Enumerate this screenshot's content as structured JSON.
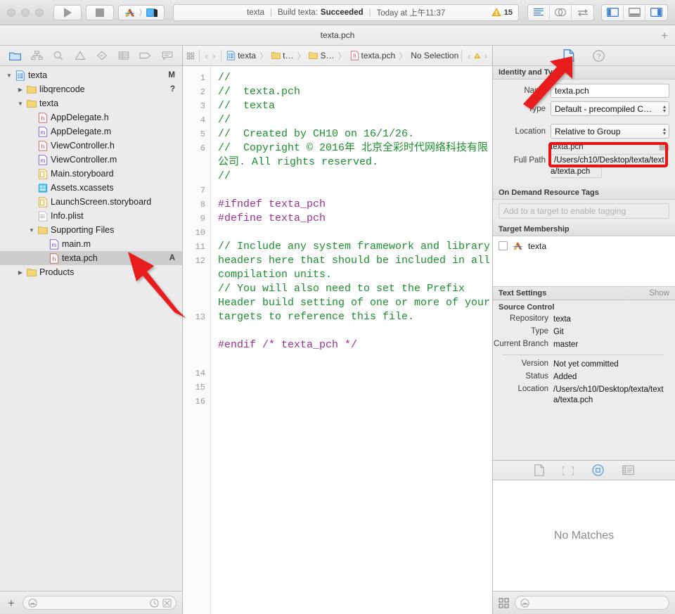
{
  "window": {
    "tab_title": "texta.pch"
  },
  "toolbar": {
    "run_icon": "play-icon",
    "stop_icon": "stop-icon",
    "scheme_name": "texta",
    "scheme_chevron": "〉",
    "activity": {
      "project": "texta",
      "sep": "|",
      "build_prefix": "Build texta:",
      "build_status": "Succeeded",
      "time": "Today at 上午11:37",
      "warning_icon": "warning-triangle-icon",
      "warning_count": "15"
    },
    "editor_segment": [
      "standard-editor-icon",
      "assistant-editor-icon",
      "version-editor-icon"
    ],
    "view_segment": [
      "navigator-toggle-icon",
      "debug-area-toggle-icon",
      "utilities-toggle-icon"
    ]
  },
  "navigator": {
    "tabs": [
      "folder-icon",
      "source-control-icon",
      "search-icon",
      "warning-icon",
      "test-icon",
      "debug-icon",
      "breakpoint-icon",
      "report-icon"
    ],
    "items": [
      {
        "label": "texta",
        "indent": 0,
        "twisty": "open",
        "icon": "project-icon",
        "status": "M"
      },
      {
        "label": "libqrencode",
        "indent": 1,
        "twisty": "closed",
        "icon": "folder-icon",
        "status": "?"
      },
      {
        "label": "texta",
        "indent": 1,
        "twisty": "open",
        "icon": "folder-icon",
        "status": ""
      },
      {
        "label": "AppDelegate.h",
        "indent": 2,
        "twisty": "none",
        "icon": "h-file-icon",
        "status": ""
      },
      {
        "label": "AppDelegate.m",
        "indent": 2,
        "twisty": "none",
        "icon": "m-file-icon",
        "status": ""
      },
      {
        "label": "ViewController.h",
        "indent": 2,
        "twisty": "none",
        "icon": "h-file-icon",
        "status": ""
      },
      {
        "label": "ViewController.m",
        "indent": 2,
        "twisty": "none",
        "icon": "m-file-icon",
        "status": ""
      },
      {
        "label": "Main.storyboard",
        "indent": 2,
        "twisty": "none",
        "icon": "storyboard-icon",
        "status": ""
      },
      {
        "label": "Assets.xcassets",
        "indent": 2,
        "twisty": "none",
        "icon": "assets-icon",
        "status": ""
      },
      {
        "label": "LaunchScreen.storyboard",
        "indent": 2,
        "twisty": "none",
        "icon": "storyboard-icon",
        "status": ""
      },
      {
        "label": "Info.plist",
        "indent": 2,
        "twisty": "none",
        "icon": "plist-icon",
        "status": ""
      },
      {
        "label": "Supporting Files",
        "indent": 2,
        "twisty": "open",
        "icon": "folder-icon",
        "status": ""
      },
      {
        "label": "main.m",
        "indent": 3,
        "twisty": "none",
        "icon": "m-file-icon",
        "status": ""
      },
      {
        "label": "texta.pch",
        "indent": 3,
        "twisty": "none",
        "icon": "h-file-icon",
        "status": "A",
        "selected": true
      },
      {
        "label": "Products",
        "indent": 1,
        "twisty": "closed",
        "icon": "folder-icon",
        "status": ""
      }
    ],
    "bottom": {
      "add_label": "+",
      "filter_placeholder": "",
      "filter_icons": [
        "recent-icon",
        "source-control-filter-icon"
      ]
    }
  },
  "editor": {
    "jumpbar": {
      "related_icon": "related-items-icon",
      "back": "‹",
      "forward": "›",
      "crumbs": [
        {
          "label": "texta",
          "icon": "project-icon"
        },
        {
          "label": "t…",
          "icon": "folder-icon"
        },
        {
          "label": "S…",
          "icon": "folder-icon"
        },
        {
          "label": "texta.pch",
          "icon": "h-file-icon"
        },
        {
          "label": "No Selection",
          "icon": ""
        }
      ],
      "issue_prev": "‹",
      "issue_icon": "warning-triangle-icon",
      "issue_next": "›"
    },
    "lines": [
      {
        "n": "1",
        "text": "//"
      },
      {
        "n": "2",
        "text": "//  texta.pch"
      },
      {
        "n": "3",
        "text": "//  texta"
      },
      {
        "n": "4",
        "text": "//"
      },
      {
        "n": "5",
        "text": "//  Created by CH10 on 16/1/26."
      },
      {
        "n": "6",
        "text": "//  Copyright © 2016年 北京全彩时代网络科技有限公司. All rights reserved.",
        "wraps": 3
      },
      {
        "n": "7",
        "text": "//"
      },
      {
        "n": "8",
        "text": ""
      },
      {
        "n": "9",
        "text": "#ifndef texta_pch",
        "kind": "preprocessor"
      },
      {
        "n": "10",
        "text": "#define texta_pch",
        "kind": "preprocessor"
      },
      {
        "n": "11",
        "text": ""
      },
      {
        "n": "12",
        "text": "// Include any system framework and library headers here that should be included in all compilation units.",
        "wraps": 4
      },
      {
        "n": "13",
        "text": "// You will also need to set the Prefix Header build setting of one or more of your targets to reference this file.",
        "wraps": 4
      },
      {
        "n": "14",
        "text": ""
      },
      {
        "n": "15",
        "text": "#endif /* texta_pch */",
        "kind": "preprocessor"
      },
      {
        "n": "16",
        "text": ""
      }
    ]
  },
  "inspector": {
    "tabs": [
      "file-inspector-icon",
      "quick-help-icon"
    ],
    "identity": {
      "section_title": "Identity and Type",
      "name_label": "Name",
      "name_value": "texta.pch",
      "type_label": "Type",
      "type_value": "Default - precompiled C…",
      "location_label": "Location",
      "location_value": "Relative to Group",
      "file_name": "texta.pch",
      "folder_icon": "folder-chooser-icon",
      "full_path_label": "Full Path",
      "full_path_value": "/Users/ch10/Desktop/texta/texta/texta.pch"
    },
    "odr": {
      "section_title": "On Demand Resource Tags",
      "placeholder": "Add to a target to enable tagging"
    },
    "target_membership": {
      "section_title": "Target Membership",
      "items": [
        {
          "label": "texta",
          "checked": false,
          "icon": "app-target-icon"
        }
      ]
    },
    "text_settings": {
      "section_title": "Text Settings",
      "show_label": "Show"
    },
    "source_control": {
      "section_title": "Source Control",
      "rows_top": [
        {
          "k": "Repository",
          "v": "texta"
        },
        {
          "k": "Type",
          "v": "Git"
        },
        {
          "k": "Current Branch",
          "v": "master"
        }
      ],
      "rows_bottom": [
        {
          "k": "Version",
          "v": "Not yet committed"
        },
        {
          "k": "Status",
          "v": "Added"
        },
        {
          "k": "Location",
          "v": "/Users/ch10/Desktop/texta/texta/texta.pch"
        }
      ]
    }
  },
  "library": {
    "tabs": [
      "file-template-library-icon",
      "code-snippet-library-icon",
      "object-library-icon",
      "media-library-icon"
    ],
    "selected_tab_index": 2,
    "empty_message": "No Matches",
    "bottom": {
      "layout_icon": "grid-layout-icon",
      "filter_placeholder": ""
    }
  },
  "annotations": {
    "accent_red": "#ee1111",
    "arrows": [
      "navigator-pointer-arrow",
      "inspector-pointer-arrow"
    ],
    "highlight_box": "full-path-highlight"
  }
}
